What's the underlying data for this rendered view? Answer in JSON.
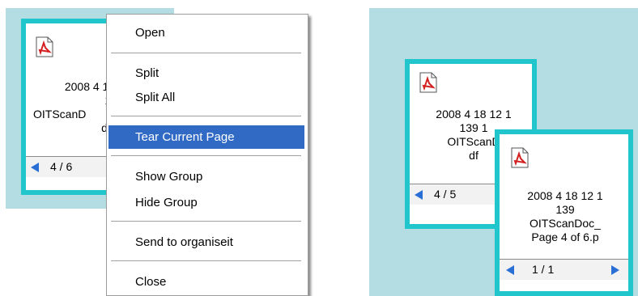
{
  "left_view": {
    "card": {
      "lines": [
        "2008 4 18",
        "139",
        "OITScanD",
        "df"
      ],
      "page_indicator": "4 / 6"
    },
    "context_menu": {
      "items": [
        "Open",
        "Split",
        "Split All",
        "Tear Current Page",
        "Show Group",
        "Hide Group",
        "Send to organiseit",
        "Close"
      ],
      "highlighted": "Tear Current Page"
    }
  },
  "right_view": {
    "back_card": {
      "lines": [
        "2008 4 18 12 1",
        "139 1",
        "OITScanD",
        "df"
      ],
      "page_indicator": "4 / 5"
    },
    "front_card": {
      "lines": [
        "2008 4 18 12 1",
        "139",
        "OITScanDoc_",
        "Page  4  of 6.p"
      ],
      "page_indicator": "1 / 1"
    }
  },
  "colors": {
    "panel_bg": "#b3dde3",
    "card_border": "#21c6cc",
    "menu_highlight": "#316ac5",
    "nav_arrow": "#2a6fd6",
    "pdf_icon": "#d42020"
  },
  "icons": [
    "pdf-icon",
    "prev-arrow-icon",
    "next-arrow-icon"
  ]
}
